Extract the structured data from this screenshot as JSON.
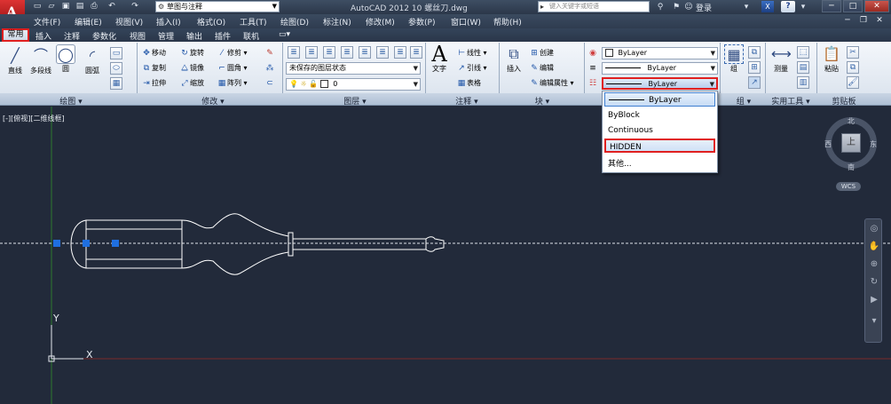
{
  "titlebar": {
    "logo_letter": "A",
    "workspace": "草图与注释",
    "app_title": "AutoCAD 2012    10 螺丝刀.dwg",
    "search_placeholder": "键入关键字或短语",
    "login_label": "登录",
    "help_label": "?",
    "exchange_label": "X"
  },
  "menubar": {
    "items": [
      "文件(F)",
      "编辑(E)",
      "视图(V)",
      "插入(I)",
      "格式(O)",
      "工具(T)",
      "绘图(D)",
      "标注(N)",
      "修改(M)",
      "参数(P)",
      "窗口(W)",
      "帮助(H)"
    ]
  },
  "ribbon_tabs": [
    "常用",
    "插入",
    "注释",
    "参数化",
    "视图",
    "管理",
    "输出",
    "插件",
    "联机"
  ],
  "draw_panel": {
    "title": "绘图",
    "tools": [
      "直线",
      "多段线",
      "圆",
      "圆弧"
    ]
  },
  "modify_panel": {
    "title": "修改",
    "tools": [
      "移动",
      "旋转",
      "修剪",
      "复制",
      "镜像",
      "圆角",
      "拉伸",
      "缩放",
      "阵列"
    ]
  },
  "layers_panel": {
    "title": "图层",
    "layer_state": "未保存的图层状态",
    "current_layer": "0"
  },
  "annotation_panel": {
    "title": "注释",
    "text_tool": "文字",
    "tools": [
      "线性",
      "引线",
      "表格"
    ]
  },
  "block_panel": {
    "title": "块",
    "insert_tool": "插入",
    "tools": [
      "创建",
      "编辑",
      "编辑属性"
    ]
  },
  "properties_panel": {
    "color": "ByLayer",
    "lineweight": "ByLayer",
    "linetype": "ByLayer"
  },
  "groups_panel": {
    "title": "组",
    "tool": "组"
  },
  "utilities_panel": {
    "title": "实用工具",
    "tool": "测量"
  },
  "clipboard_panel": {
    "title": "剪贴板",
    "tool": "粘贴"
  },
  "viewport": {
    "label": "[-][俯视][二维线框]"
  },
  "linetype_dropdown": {
    "items": [
      "ByLayer",
      "ByBlock",
      "Continuous",
      "HIDDEN",
      "其他..."
    ],
    "selected": "ByLayer",
    "highlighted": "HIDDEN"
  },
  "viewcube": {
    "north": "北",
    "south": "南",
    "east": "东",
    "west": "西",
    "face": "上",
    "wcs": "WCS"
  },
  "ucs": {
    "x_label": "X",
    "y_label": "Y"
  },
  "colors": {
    "canvas_bg": "#222a3a",
    "highlight_red": "#e02020",
    "grip_blue": "#1f6fe0",
    "drawing_white": "#ffffff"
  }
}
